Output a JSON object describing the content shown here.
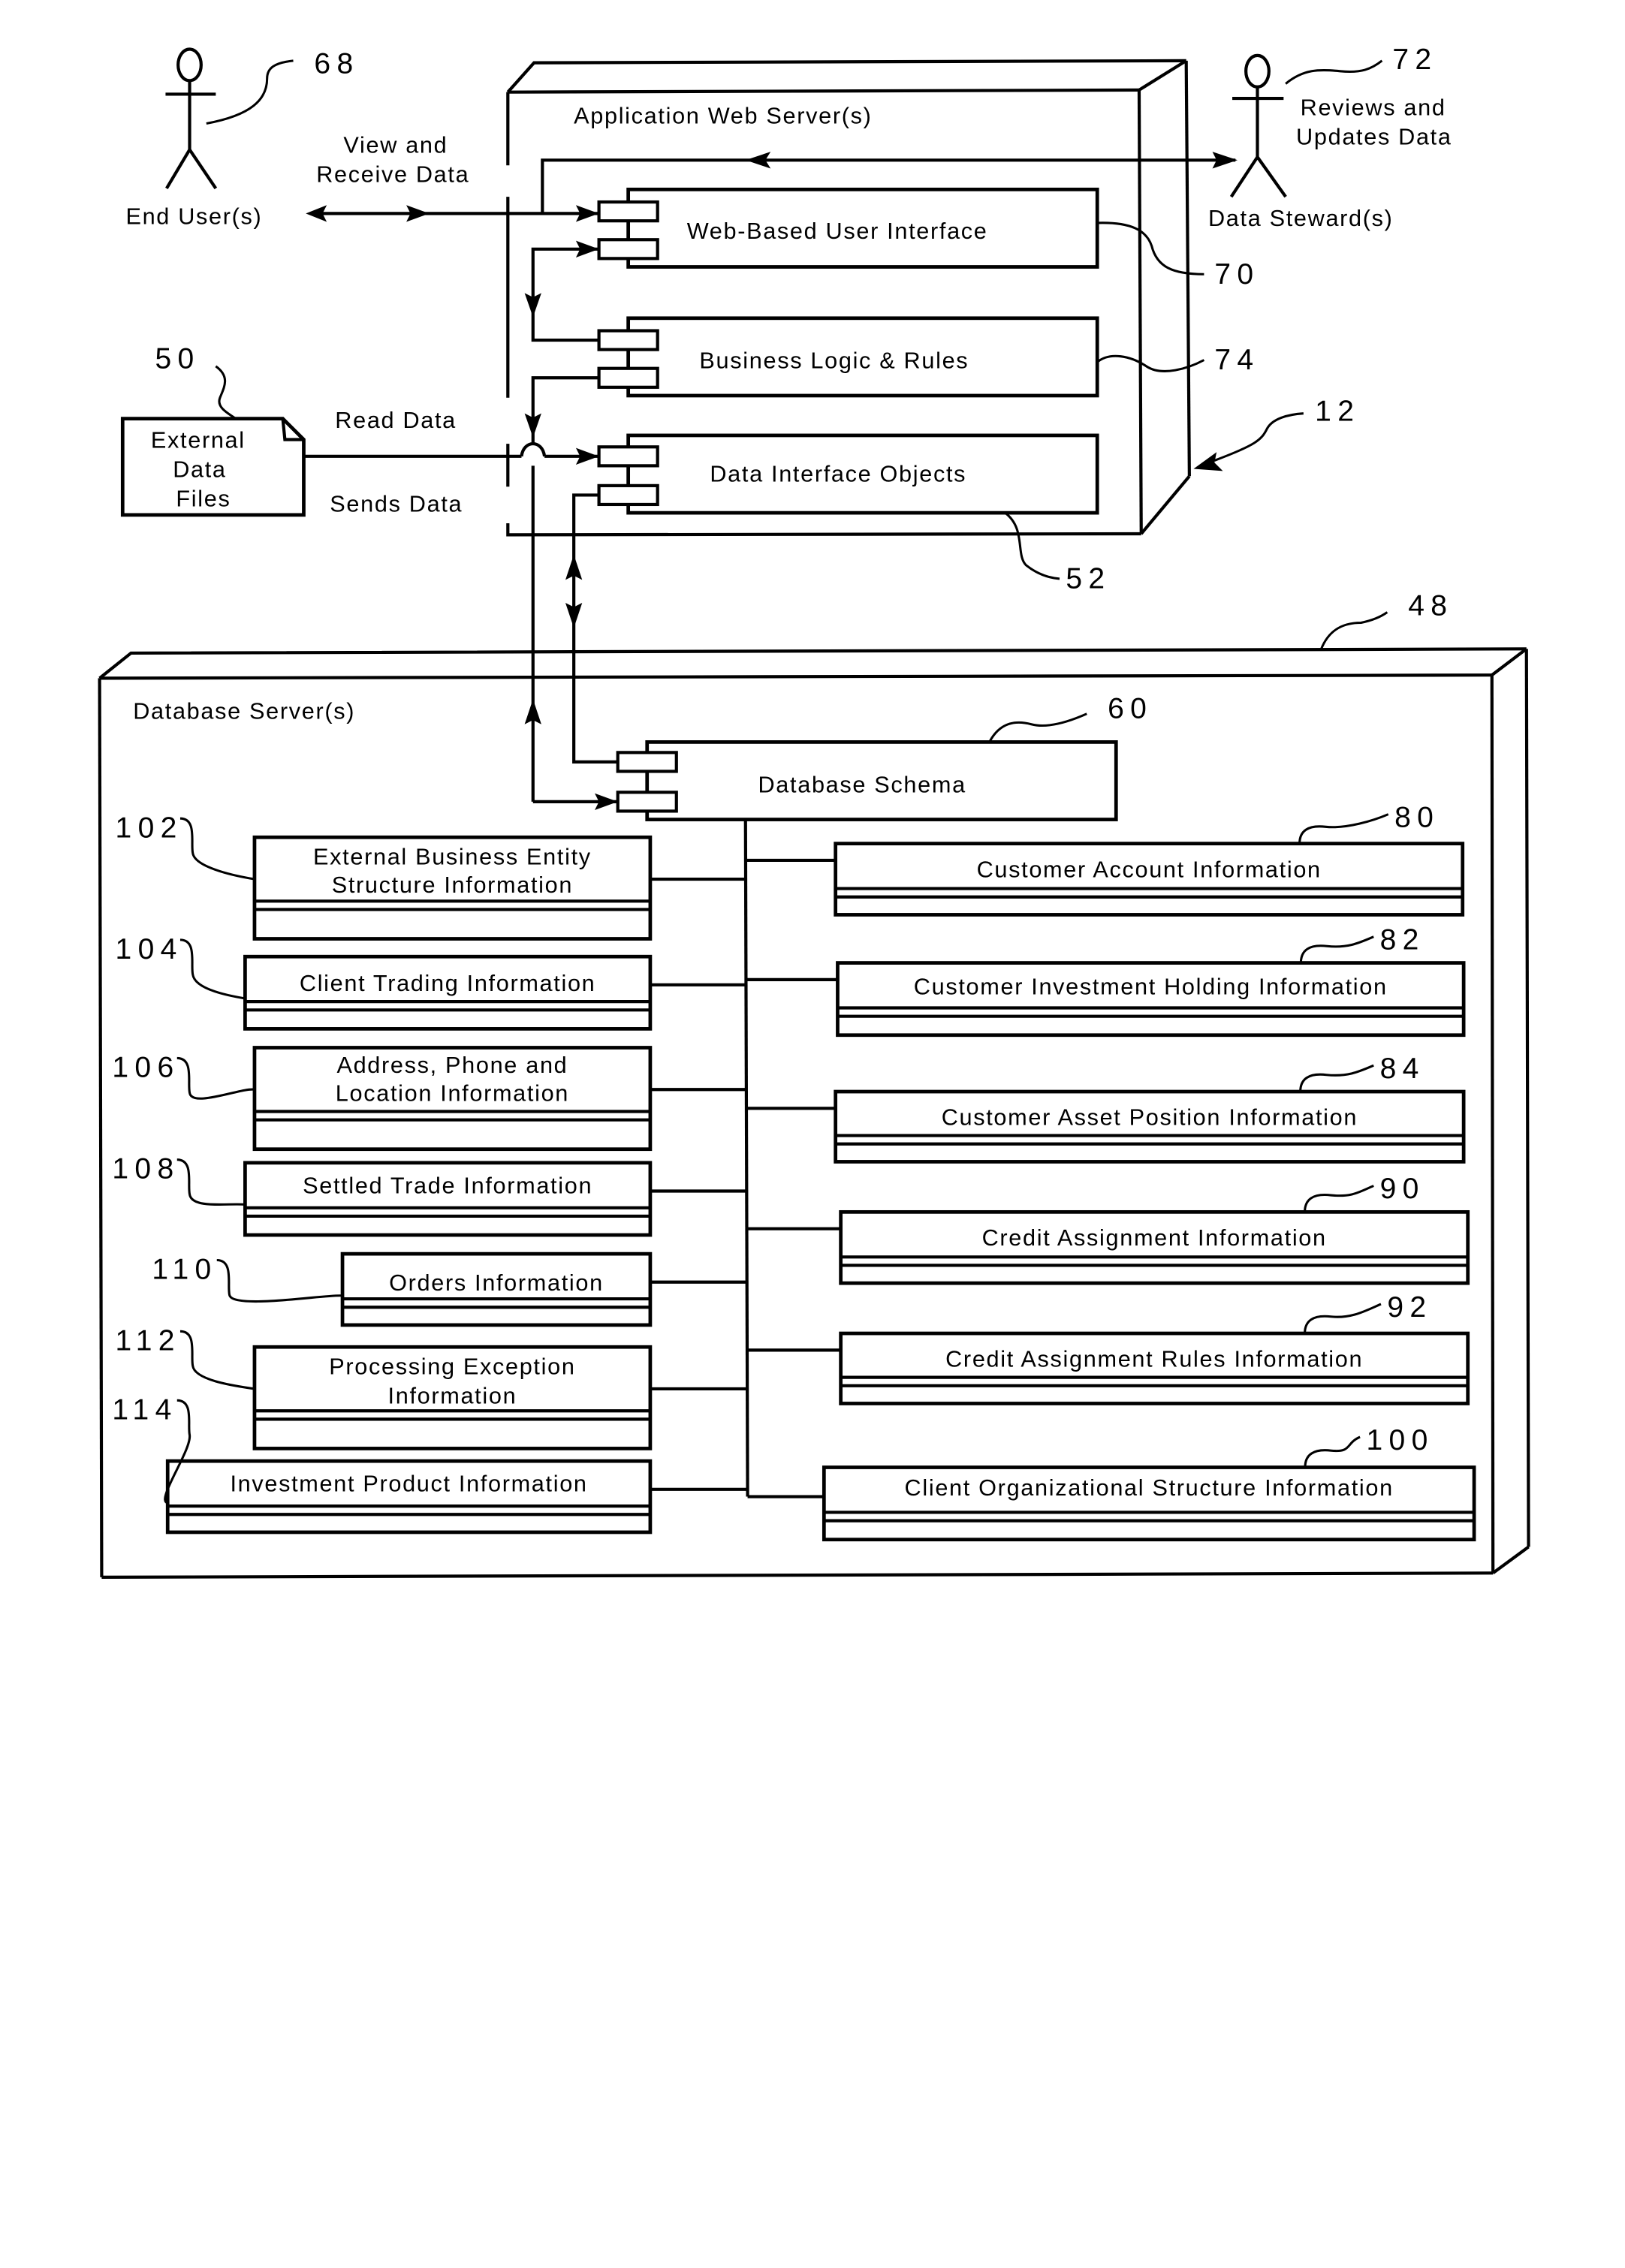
{
  "diagram": {
    "app_server": {
      "label": "Application Web Server(s)",
      "ref": "12",
      "components": [
        {
          "id": "wui",
          "label": "Web-Based User Interface",
          "ref": "70"
        },
        {
          "id": "blr",
          "label": "Business Logic & Rules",
          "ref": "74"
        },
        {
          "id": "dio",
          "label": "Data Interface Objects",
          "ref": "52"
        }
      ]
    },
    "actors": {
      "end_user": {
        "label": "End User(s)",
        "ref": "68"
      },
      "data_steward": {
        "label": "Data Steward(s)",
        "ref": "72",
        "note_line1": "Reviews and",
        "note_line2": "Updates Data"
      }
    },
    "external_files": {
      "line1": "External",
      "line2": "Data",
      "line3": "Files",
      "ref": "50"
    },
    "flow_labels": {
      "view_line1": "View and",
      "view_line2": "Receive Data",
      "read": "Read Data",
      "sends": "Sends Data"
    },
    "db_server": {
      "label": "Database Server(s)",
      "ref": "48",
      "schema": {
        "label": "Database Schema",
        "ref": "60"
      },
      "left_tables": [
        {
          "ref": "102",
          "line1": "External Business Entity",
          "line2": "Structure Information"
        },
        {
          "ref": "104",
          "line1": "Client Trading Information",
          "line2": ""
        },
        {
          "ref": "106",
          "line1": "Address, Phone and",
          "line2": "Location Information"
        },
        {
          "ref": "108",
          "line1": "Settled Trade Information",
          "line2": ""
        },
        {
          "ref": "110",
          "line1": "Orders Information",
          "line2": ""
        },
        {
          "ref": "112",
          "line1": "Processing Exception",
          "line2": "Information"
        },
        {
          "ref": "114",
          "line1": "Investment Product Information",
          "line2": ""
        }
      ],
      "right_tables": [
        {
          "ref": "80",
          "line1": "Customer Account Information"
        },
        {
          "ref": "82",
          "line1": "Customer Investment Holding Information"
        },
        {
          "ref": "84",
          "line1": "Customer Asset Position Information"
        },
        {
          "ref": "90",
          "line1": "Credit Assignment Information"
        },
        {
          "ref": "92",
          "line1": "Credit Assignment Rules Information"
        },
        {
          "ref": "100",
          "line1": "Client Organizational Structure Information"
        }
      ]
    }
  }
}
